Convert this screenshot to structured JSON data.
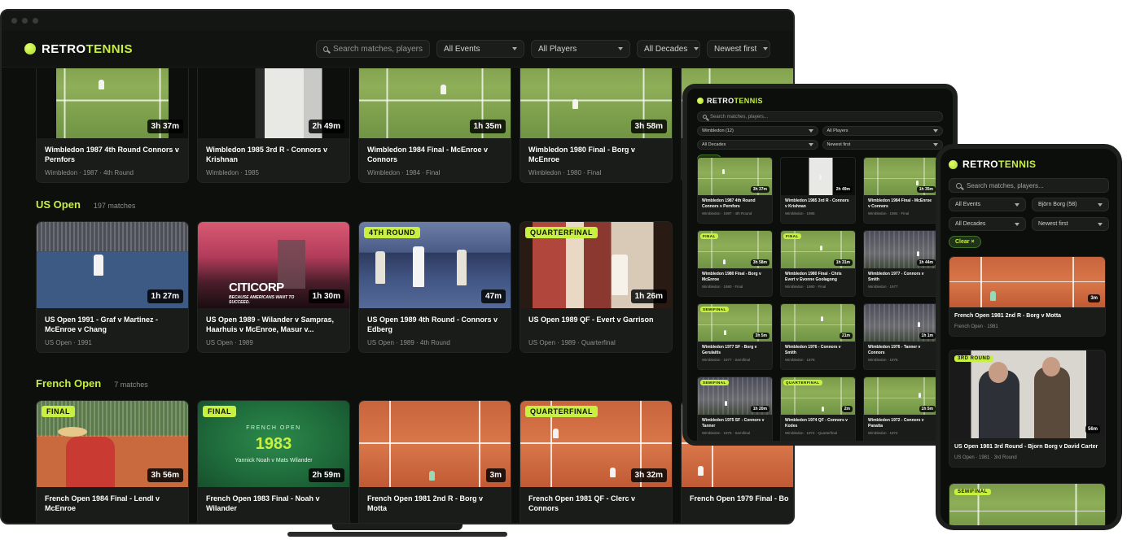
{
  "brand": {
    "name_a": "RETRO",
    "name_b": "TENNIS",
    "accent": "#c8f041"
  },
  "laptop": {
    "search_placeholder": "Search matches, players",
    "filters": [
      "All Events",
      "All Players",
      "All Decades",
      "Newest first"
    ],
    "wimbledon_row": [
      {
        "title": "Wimbledon 1987 4th Round Connors v Pernfors",
        "sub": "Wimbledon · 1987 · 4th Round",
        "dur": "3h 37m"
      },
      {
        "title": "Wimbledon 1985 3rd R - Connors v Krishnan",
        "sub": "Wimbledon · 1985",
        "dur": "2h 49m"
      },
      {
        "title": "Wimbledon 1984 Final - McEnroe v Connors",
        "sub": "Wimbledon · 1984 · Final",
        "dur": "1h 35m"
      },
      {
        "title": "Wimbledon 1980 Final - Borg v McEnroe",
        "sub": "Wimbledon · 1980 · Final",
        "dur": "3h 58m"
      }
    ],
    "us_open": {
      "name": "US Open",
      "count": "197 matches",
      "cards": [
        {
          "title": "US Open 1991 - Graf v Martinez - McEnroe v Chang",
          "sub": "US Open · 1991",
          "dur": "1h 27m",
          "badge": ""
        },
        {
          "title": "US Open 1989 - Wilander v Sampras, Haarhuis v McEnroe, Masur v...",
          "sub": "US Open · 1989",
          "dur": "1h 30m",
          "badge": "",
          "ad_title": "CITICORP",
          "ad_sub": "BECAUSE AMERICANS WANT TO SUCCEED."
        },
        {
          "title": "US Open 1989 4th Round - Connors v Edberg",
          "sub": "US Open · 1989 · 4th Round",
          "dur": "47m",
          "badge": "4TH ROUND"
        },
        {
          "title": "US Open 1989 QF - Evert v Garrison",
          "sub": "US Open · 1989 · Quarterfinal",
          "dur": "1h 26m",
          "badge": "QUARTERFINAL"
        }
      ]
    },
    "french_open": {
      "name": "French Open",
      "count": "7 matches",
      "cards": [
        {
          "title": "French Open 1984 Final - Lendl v McEnroe",
          "dur": "3h 56m",
          "badge": "FINAL"
        },
        {
          "title": "French Open 1983 Final - Noah v Wilander",
          "dur": "2h 59m",
          "badge": "FINAL",
          "poster_event": "FRENCH OPEN",
          "poster_year": "1983",
          "poster_players": "Yannick Noah v Mats Wilander"
        },
        {
          "title": "French Open 1981 2nd R - Borg v Motta",
          "dur": "3m",
          "badge": ""
        },
        {
          "title": "French Open 1981 QF - Clerc v Connors",
          "dur": "3h 32m",
          "badge": "QUARTERFINAL"
        },
        {
          "title": "French Open 1979 Final - Bo",
          "dur": "",
          "badge": ""
        }
      ]
    }
  },
  "tablet": {
    "search_placeholder": "Search matches, players...",
    "filters": [
      "Wimbledon (12)",
      "All Players",
      "All Decades",
      "Newest first"
    ],
    "clear": "Clear ×",
    "cards": [
      {
        "title": "Wimbledon 1987 4th Round Connors v Pernfors",
        "sub": "Wimbledon · 1987 · 4th Round",
        "dur": "3h 37m",
        "badge": ""
      },
      {
        "title": "Wimbledon 1985 3rd R - Connors v Krishnan",
        "sub": "Wimbledon · 1985",
        "dur": "2h 49m",
        "badge": ""
      },
      {
        "title": "Wimbledon 1984 Final - McEnroe v Connors",
        "sub": "Wimbledon · 1984 · Final",
        "dur": "1h 35m",
        "badge": ""
      },
      {
        "title": "Wimbledon 1980 Final - Borg v McEnroe",
        "sub": "Wimbledon · 1980 · Final",
        "dur": "3h 58m",
        "badge": "FINAL"
      },
      {
        "title": "Wimbledon 1980 Final - Chris Evert v Evonne Goolagong Cawley",
        "sub": "Wimbledon · 1980 · Final",
        "dur": "1h 31m",
        "badge": "FINAL"
      },
      {
        "title": "Wimbledon 1977 - Connors v Smith",
        "sub": "Wimbledon · 1977",
        "dur": "1h 44m",
        "badge": ""
      },
      {
        "title": "Wimbledon 1977 SF - Borg v Gerulaitis",
        "sub": "Wimbledon · 1977 · Semifinal",
        "dur": "3h 5m",
        "badge": "SEMIFINAL"
      },
      {
        "title": "Wimbledon 1976 - Connors v Smith",
        "sub": "Wimbledon · 1976",
        "dur": "21m",
        "badge": ""
      },
      {
        "title": "Wimbledon 1976 - Tanner v Connors",
        "sub": "Wimbledon · 1976",
        "dur": "1h 1m",
        "badge": ""
      },
      {
        "title": "Wimbledon 1975 SF - Connors v Tanner",
        "sub": "Wimbledon · 1975 · Semifinal",
        "dur": "1h 20m",
        "badge": "SEMIFINAL"
      },
      {
        "title": "Wimbledon 1974 QF - Connors v Kodes",
        "sub": "Wimbledon · 1974 · Quarterfinal",
        "dur": "2m",
        "badge": "QUARTERFINAL"
      },
      {
        "title": "Wimbledon 1972 - Connors v Panatta",
        "sub": "Wimbledon · 1972",
        "dur": "1h 5m",
        "badge": ""
      }
    ]
  },
  "phone": {
    "search_placeholder": "Search matches, players...",
    "filters": [
      "All Events",
      "Björn Borg (58)",
      "All Decades",
      "Newest first"
    ],
    "clear": "Clear ×",
    "cards": [
      {
        "title": "French Open 1981 2nd R - Borg v Motta",
        "sub": "French Open · 1981",
        "dur": "3m",
        "badge": ""
      },
      {
        "title": "US Open 1981 3rd Round - Bjorn Borg v David Carter",
        "sub": "US Open · 1981 · 3rd Round",
        "dur": "56m",
        "badge": "3RD ROUND"
      },
      {
        "title": "",
        "sub": "",
        "dur": "",
        "badge": "SEMIFINAL"
      }
    ]
  }
}
